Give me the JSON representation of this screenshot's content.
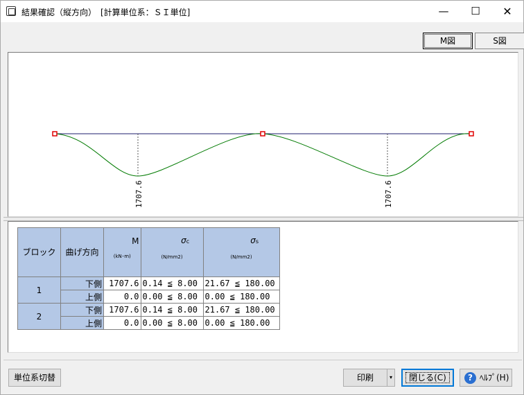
{
  "window": {
    "title": "結果確認（縦方向）　[計算単位系：ＳＩ単位]",
    "minimize_glyph": "—",
    "maximize_glyph": "☐",
    "close_glyph": "✕"
  },
  "tabs": [
    {
      "label": "M図",
      "selected": true
    },
    {
      "label": "S図",
      "selected": false
    }
  ],
  "diagram": {
    "line_color": "#1c1c6e",
    "curve_color": "#007a00",
    "support_color": "#e00000",
    "labels": [
      "1707.6",
      "1707.6"
    ]
  },
  "table": {
    "headers": {
      "block": "ブロック",
      "direction": "曲げ方向",
      "m": "M",
      "m_unit": "(kN･m)",
      "sc": "σ",
      "sc_sub": "c",
      "sc_unit": "(N/mm2)",
      "ss": "σ",
      "ss_sub": "s",
      "ss_unit": "(N/mm2)"
    },
    "rows": [
      {
        "block": "1",
        "dir": "下側",
        "m": "1707.6",
        "sc": "0.14 ≦ 8.00",
        "ss": "21.67 ≦ 180.00"
      },
      {
        "block": "",
        "dir": "上側",
        "m": "0.0",
        "sc": "0.00 ≦ 8.00",
        "ss": "0.00 ≦ 180.00"
      },
      {
        "block": "2",
        "dir": "下側",
        "m": "1707.6",
        "sc": "0.14 ≦ 8.00",
        "ss": "21.67 ≦ 180.00"
      },
      {
        "block": "",
        "dir": "上側",
        "m": "0.0",
        "sc": "0.00 ≦ 8.00",
        "ss": "0.00 ≦ 180.00"
      }
    ],
    "header_color": "#b4c8e6"
  },
  "buttons": {
    "unit_switch": "単位系切替",
    "print": "印刷",
    "print_dropdown": "▾",
    "close": "閉じる(C)",
    "help": "ﾍﾙﾌﾟ(H)",
    "help_icon": "?"
  }
}
